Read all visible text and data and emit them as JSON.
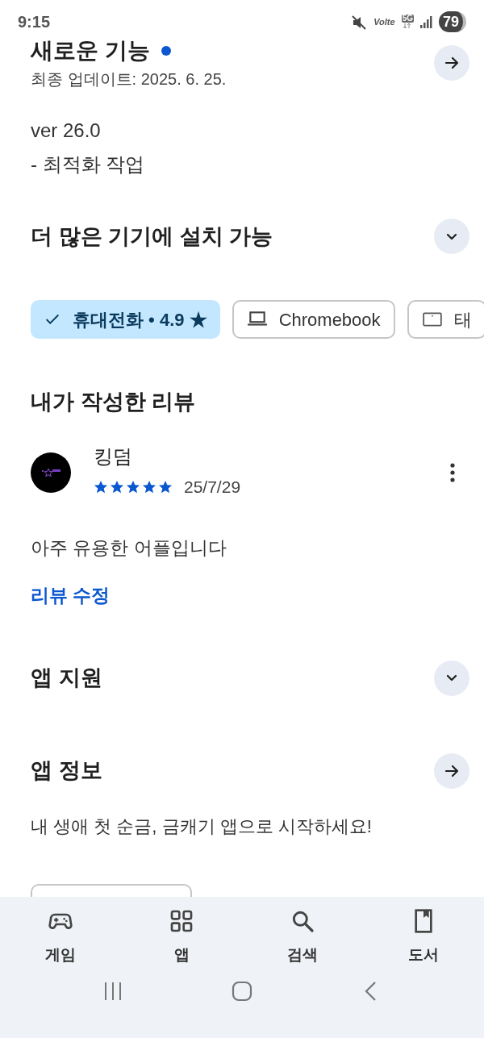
{
  "status_bar": {
    "time": "9:15",
    "volte": "Volte",
    "network": "5G",
    "battery": "79"
  },
  "whats_new": {
    "title": "새로운 기능",
    "new": true,
    "updated": "최종 업데이트: 2025. 6. 25.",
    "notes": [
      "ver 26.0",
      "- 최적화 작업"
    ]
  },
  "devices": {
    "title": "더 많은 기기에 설치 가능",
    "expanded": false,
    "chips": [
      {
        "kind": "phone",
        "label": "휴대전화 • 4.9 ★",
        "selected": true
      },
      {
        "kind": "laptop",
        "label": "Chromebook",
        "selected": false
      },
      {
        "kind": "tablet",
        "label": "태",
        "selected": false
      }
    ]
  },
  "my_review": {
    "title": "내가 작성한 리뷰",
    "author": "킹덤",
    "stars": 5,
    "date": "25/7/29",
    "text": "아주 유용한 어플입니다",
    "edit_link": "리뷰 수정"
  },
  "sections": [
    {
      "kind": "expand",
      "title": "앱 지원",
      "expanded": false
    },
    {
      "kind": "arrow",
      "title": "앱 정보",
      "description": "내 생애 첫 순금, 금캐기 앱으로 시작하세요!"
    }
  ],
  "bottom_nav": [
    {
      "kind": "games",
      "label": "게임"
    },
    {
      "kind": "apps",
      "label": "앱"
    },
    {
      "kind": "search",
      "label": "검색"
    },
    {
      "kind": "books",
      "label": "도서"
    }
  ]
}
